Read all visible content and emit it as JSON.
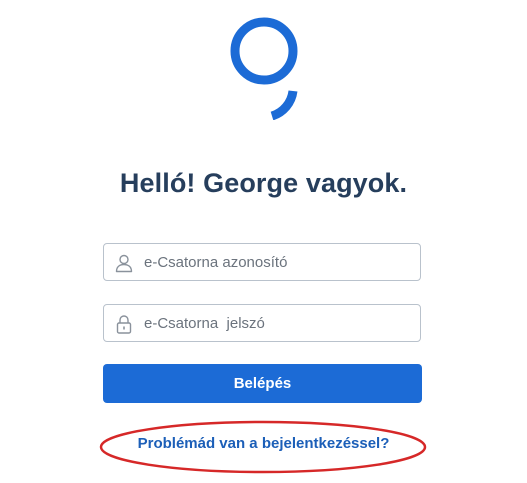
{
  "brand": {
    "logo_icon": "george-logo-icon",
    "accent_color": "#1c6bd6"
  },
  "header": {
    "title": "Helló! George vagyok."
  },
  "form": {
    "username": {
      "placeholder": "e-Csatorna azonosító",
      "value": "",
      "icon": "user-icon"
    },
    "password": {
      "placeholder": "e-Csatorna  jelszó",
      "value": "",
      "icon": "lock-icon"
    },
    "submit_label": "Belépés"
  },
  "help": {
    "link_text": "Problémád van a bejelentkezéssel?"
  },
  "annotation": {
    "color": "#d62828"
  }
}
